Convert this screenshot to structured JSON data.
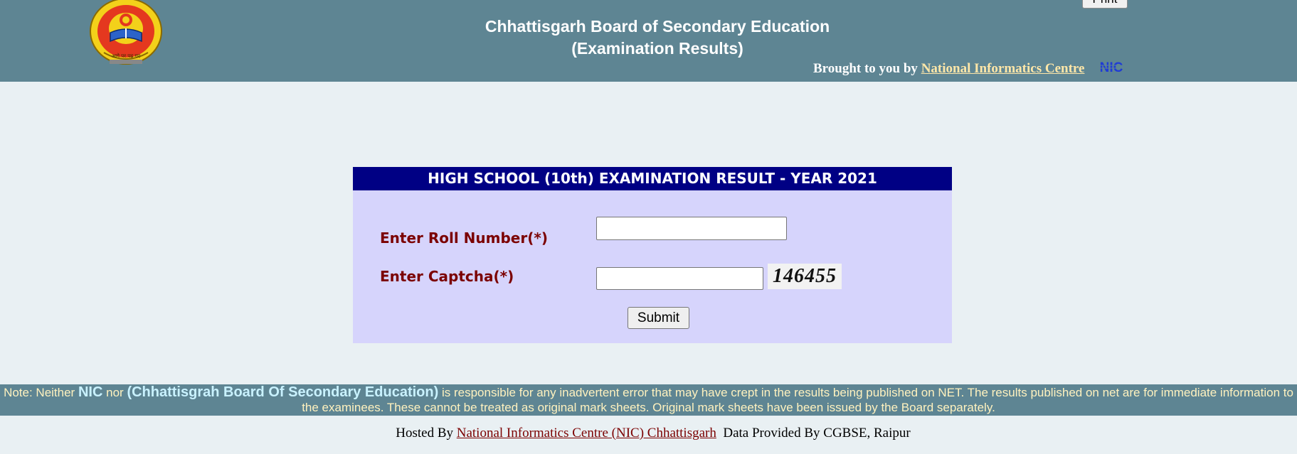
{
  "header": {
    "title_line1": "Chhattisgarh Board of Secondary Education",
    "title_line2": "(Examination Results)",
    "print_label": "Print",
    "brought_prefix": "Brought to you by ",
    "nic_link": "National Informatics Centre",
    "nic_logo_text": "NIC",
    "logo_text": "आगे पर पढ़ गए"
  },
  "form": {
    "heading": "HIGH SCHOOL (10th) EXAMINATION RESULT - YEAR 2021",
    "roll_label": "Enter Roll Number(*)",
    "roll_value": "",
    "captcha_label": "Enter Captcha(*)",
    "captcha_value": "",
    "captcha_code": "146455",
    "submit_label": "Submit"
  },
  "note": {
    "prefix": "Note: Neither ",
    "nic": "NIC",
    "mid": " nor ",
    "board": "(Chhattisgrah Board Of Secondary Education)",
    "rest": " is responsible for any inadvertent error that may have crept in the results being published on NET. The results published on net are for immediate information to the examinees. These cannot be treated as original mark sheets. Original mark sheets have been issued by the Board separately."
  },
  "footer": {
    "hosted_prefix": "Hosted By ",
    "hosted_link": "National Informatics Centre (NIC) Chhattisgarh",
    "data_text": "  Data Provided By CGBSE, Raipur"
  },
  "colors": {
    "header_bg": "#5e8593",
    "page_bg": "#e9f0f3",
    "form_bg": "#d6d4fc",
    "form_heading_bg": "#000084",
    "label_color": "#7b0000"
  }
}
